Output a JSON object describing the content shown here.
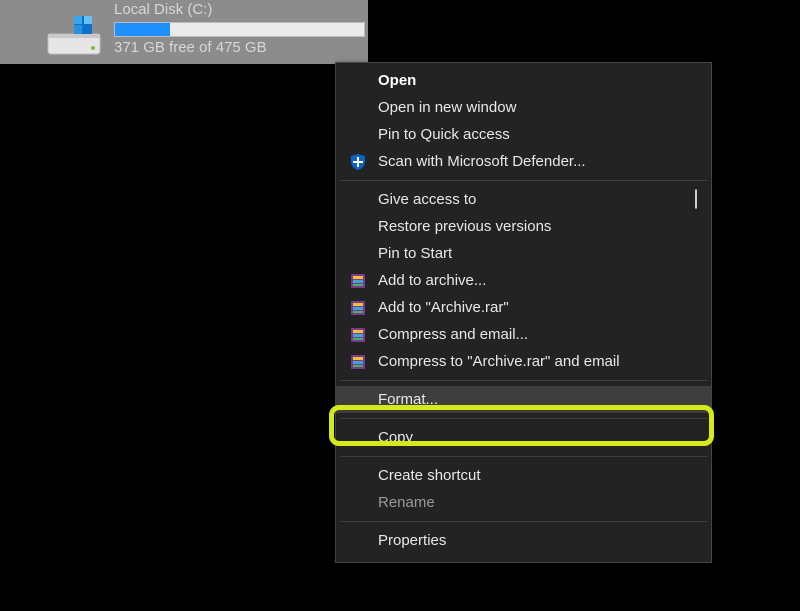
{
  "drive": {
    "name": "Local Disk (C:)",
    "free_text": "371 GB free of 475 GB",
    "used_percent": 22
  },
  "menu": {
    "open": "Open",
    "open_new_window": "Open in new window",
    "pin_quick_access": "Pin to Quick access",
    "defender": "Scan with Microsoft Defender...",
    "give_access": "Give access to",
    "restore_versions": "Restore previous versions",
    "pin_start": "Pin to Start",
    "add_archive": "Add to archive...",
    "add_archive_rar": "Add to \"Archive.rar\"",
    "compress_email": "Compress and email...",
    "compress_rar_email": "Compress to \"Archive.rar\" and email",
    "format": "Format...",
    "copy": "Copy",
    "create_shortcut": "Create shortcut",
    "rename": "Rename",
    "properties": "Properties"
  }
}
